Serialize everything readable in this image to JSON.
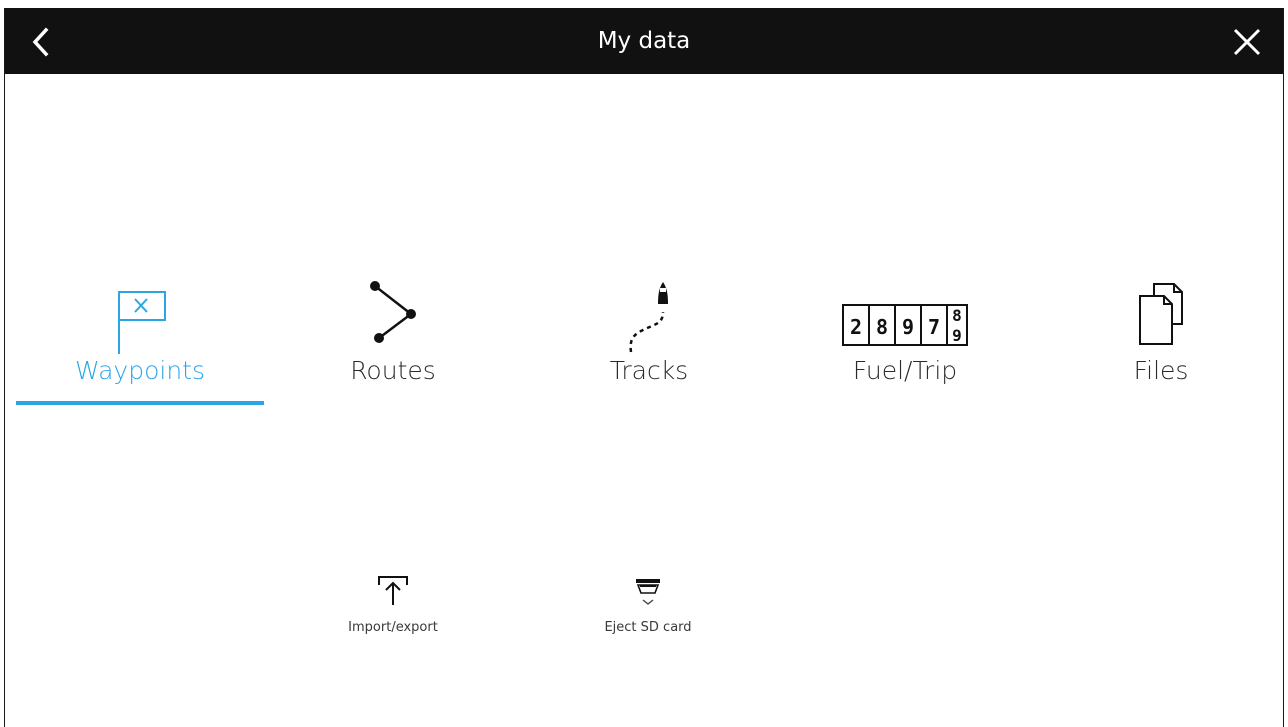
{
  "header": {
    "title": "My data",
    "back_icon": "chevron-left-icon",
    "close_icon": "close-icon"
  },
  "tabs": [
    {
      "label": "Waypoints",
      "icon": "waypoint-flag-icon",
      "active": true
    },
    {
      "label": "Routes",
      "icon": "route-icon",
      "active": false
    },
    {
      "label": "Tracks",
      "icon": "track-icon",
      "active": false
    },
    {
      "label": "Fuel/Trip",
      "icon": "fuel-trip-counter-icon",
      "active": false,
      "counter_digits": [
        "2",
        "8",
        "9",
        "7"
      ],
      "counter_roll_top": "8",
      "counter_roll_bottom": "9"
    },
    {
      "label": "Files",
      "icon": "files-icon",
      "active": false
    }
  ],
  "actions": [
    {
      "label": "Import/export",
      "icon": "import-export-icon"
    },
    {
      "label": "Eject SD card",
      "icon": "eject-sd-card-icon"
    }
  ],
  "colors": {
    "accent": "#2aa6e6",
    "titlebar": "#111111",
    "text": "#2b2b2b"
  }
}
